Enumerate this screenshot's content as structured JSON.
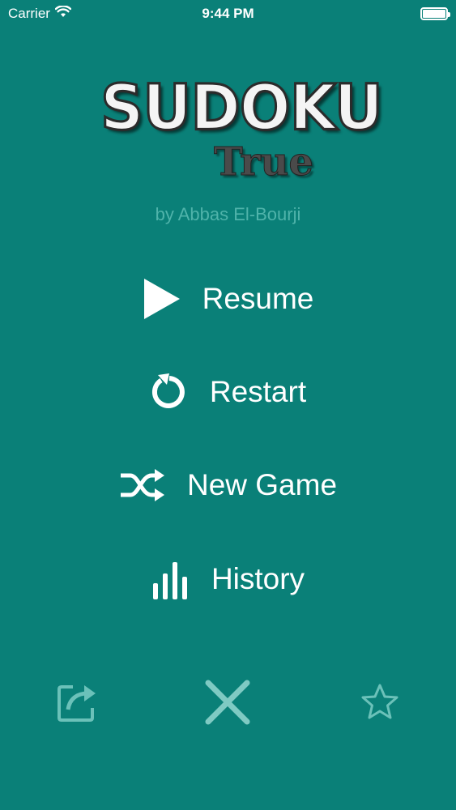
{
  "status_bar": {
    "carrier": "Carrier",
    "time": "9:44 PM"
  },
  "logo": {
    "title": "SUDOKU",
    "subtitle": "True"
  },
  "author": "by Abbas El-Bourji",
  "menu": {
    "resume": "Resume",
    "restart": "Restart",
    "new_game": "New Game",
    "history": "History"
  },
  "icons": {
    "resume": "play-icon",
    "restart": "restart-icon",
    "new_game": "shuffle-icon",
    "history": "bar-chart-icon",
    "share": "share-icon",
    "close": "close-icon",
    "rate": "star-icon"
  },
  "colors": {
    "background": "#0a8078",
    "author_text": "#4fb3aa",
    "bottom_icons": "#6bc1b9",
    "close_icon": "#7fcac3"
  }
}
